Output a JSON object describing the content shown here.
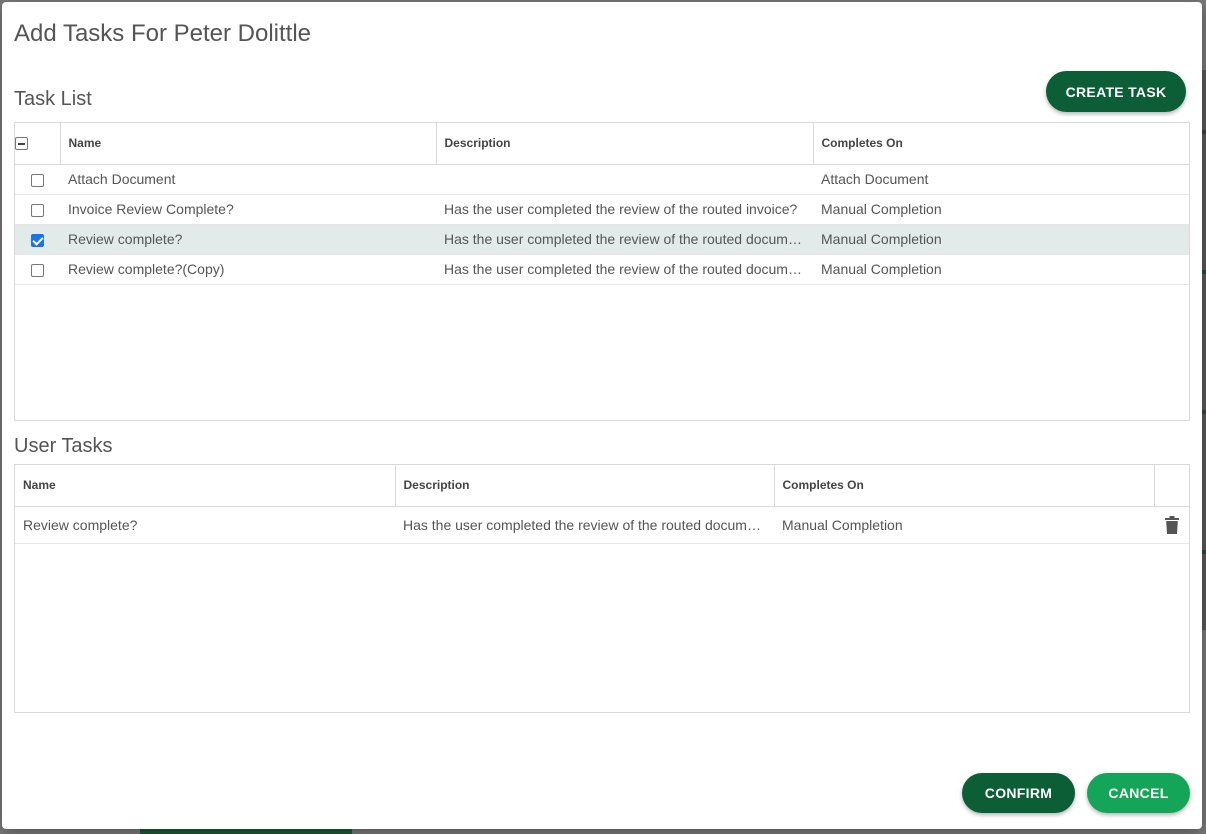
{
  "dialog": {
    "title": "Add Tasks For Peter Dolittle"
  },
  "task_list": {
    "title": "Task List",
    "create_button": "CREATE TASK",
    "columns": [
      "Name",
      "Description",
      "Completes On"
    ],
    "rows": [
      {
        "name": "Attach Document",
        "description": "",
        "completes_on": "Attach Document",
        "checked": false
      },
      {
        "name": "Invoice Review Complete?",
        "description": "Has the user completed the review of the routed invoice?",
        "completes_on": "Manual Completion",
        "checked": false
      },
      {
        "name": "Review complete?",
        "description": "Has the user completed the review of the routed document?",
        "completes_on": "Manual Completion",
        "checked": true
      },
      {
        "name": "Review complete?(Copy)",
        "description": "Has the user completed the review of the routed document?",
        "completes_on": "Manual Completion",
        "checked": false
      }
    ]
  },
  "user_tasks": {
    "title": "User Tasks",
    "columns": [
      "Name",
      "Description",
      "Completes On"
    ],
    "rows": [
      {
        "name": "Review complete?",
        "description": "Has the user completed the review of the routed document?",
        "completes_on": "Manual Completion",
        "icon": "trash-icon"
      }
    ]
  },
  "footer": {
    "confirm_label": "CONFIRM",
    "cancel_label": "CANCEL"
  },
  "colors": {
    "primary_dark": "#0b5e35",
    "primary_light": "#14a558",
    "selected_row": "#e3eaea",
    "checkbox_checked": "#1a73e8"
  }
}
